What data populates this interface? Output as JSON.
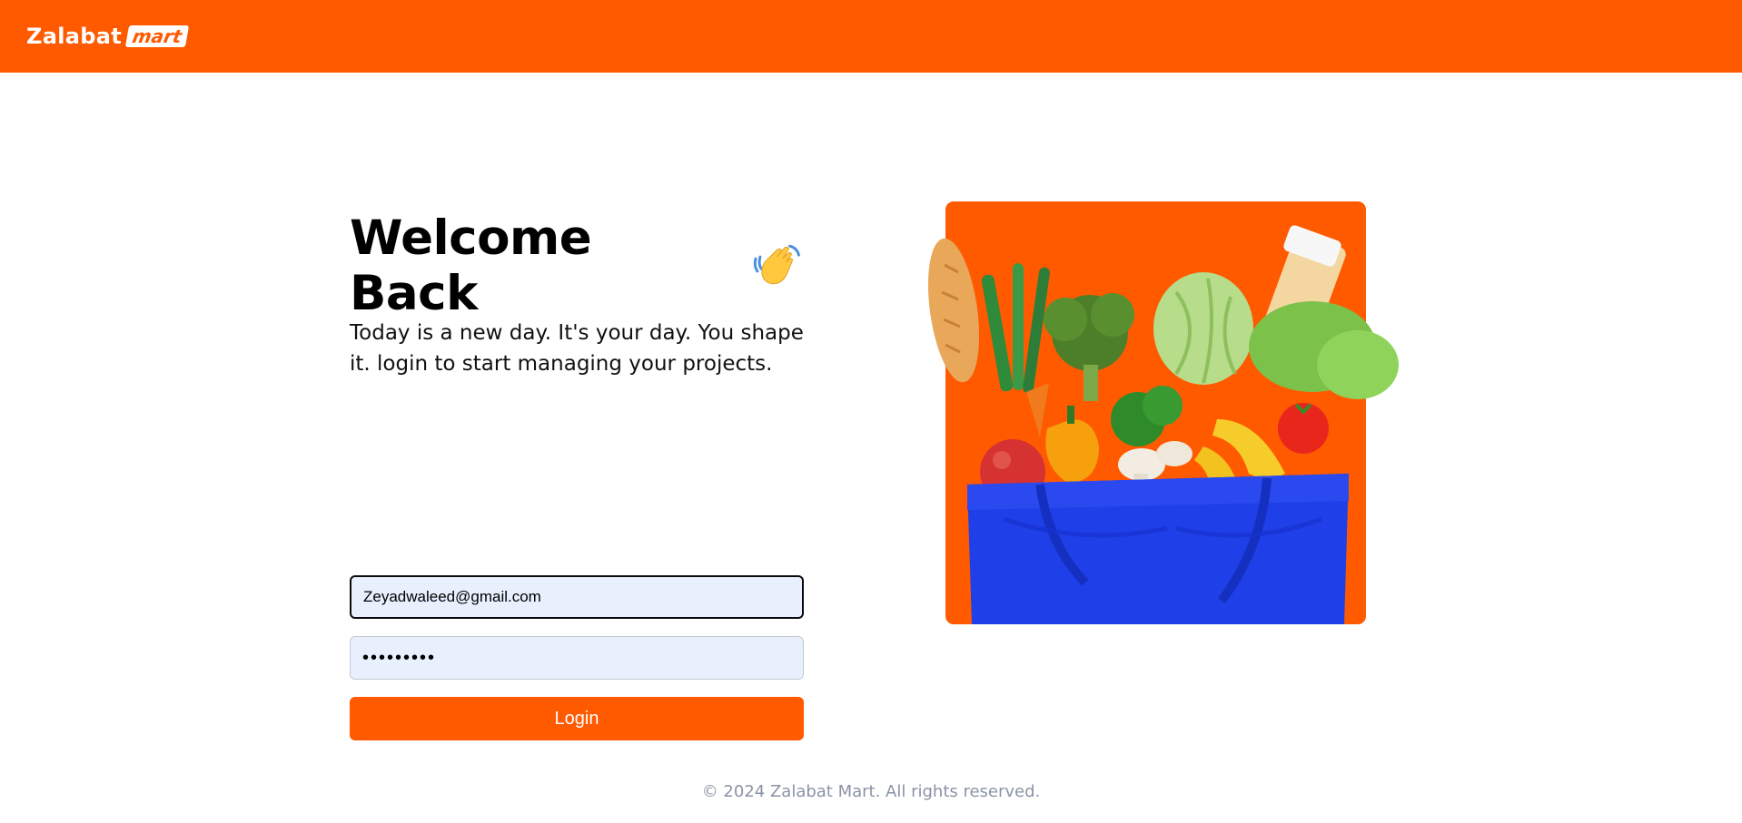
{
  "header": {
    "logo_main": "Zalabat",
    "logo_tag": "mart",
    "brand_color": "#ff5a00"
  },
  "login": {
    "title": "Welcome Back",
    "wave_icon": "waving-hand-emoji",
    "subtitle": "Today is a new day. It's your day. You shape it. login to start managing your projects.",
    "email_value": "Zeyadwaleed@gmail.com",
    "password_value": "•••••••••",
    "login_label": "Login"
  },
  "hero": {
    "image": "grocery-bag-illustration"
  },
  "footer": {
    "copyright": "© 2024 Zalabat Mart. All rights reserved."
  }
}
